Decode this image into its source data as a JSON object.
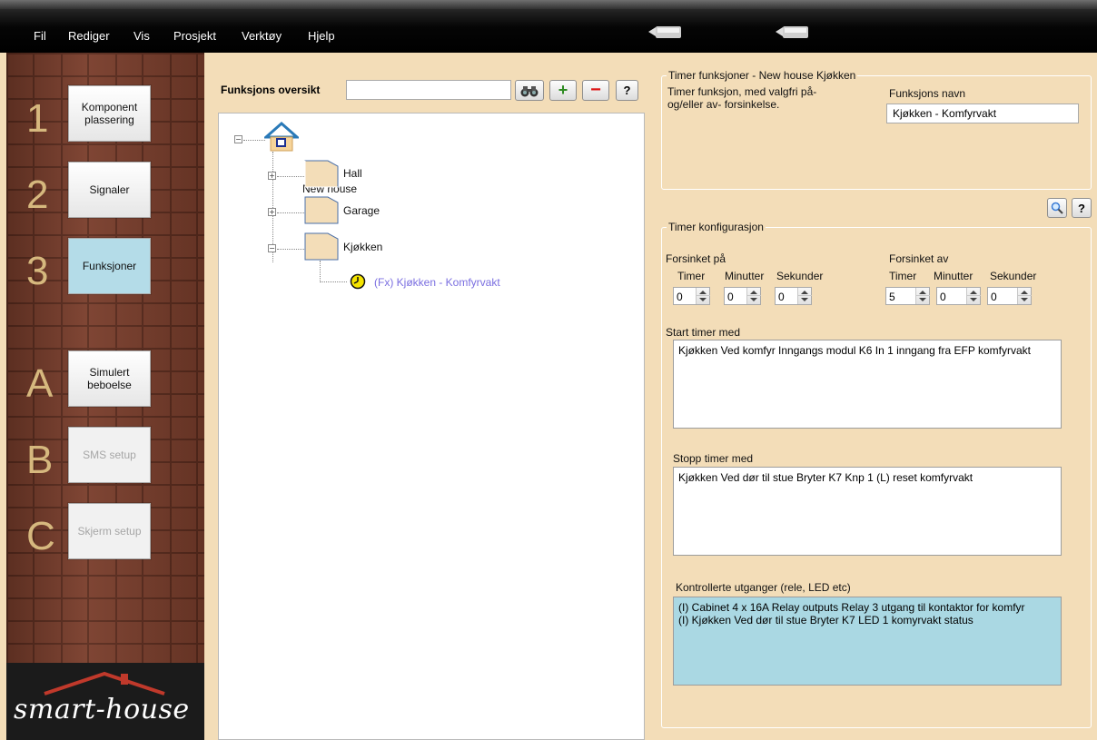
{
  "menu": [
    "Fil",
    "Rediger",
    "Vis",
    "Prosjekt",
    "Verktøy",
    "Hjelp"
  ],
  "nav": {
    "back_icon": "back-arrow-icon",
    "forward_icon": "forward-arrow-icon"
  },
  "sidebar": {
    "steps": [
      {
        "num": "1",
        "label_line1": "Komponent",
        "label_line2": "plassering",
        "state": "normal"
      },
      {
        "num": "2",
        "label_line1": "Signaler",
        "label_line2": "",
        "state": "normal"
      },
      {
        "num": "3",
        "label_line1": "Funksjoner",
        "label_line2": "",
        "state": "active"
      },
      {
        "num": "A",
        "label_line1": "Simulert",
        "label_line2": "beboelse",
        "state": "normal"
      },
      {
        "num": "B",
        "label_line1": "SMS setup",
        "label_line2": "",
        "state": "disabled"
      },
      {
        "num": "C",
        "label_line1": "Skjerm setup",
        "label_line2": "",
        "state": "disabled"
      }
    ],
    "logo_text": "smart-house"
  },
  "overview": {
    "label": "Funksjons oversikt",
    "search_value": "",
    "buttons": {
      "find_icon": "binoculars-icon",
      "add": "+",
      "remove": "−",
      "help": "?"
    },
    "tree": {
      "root": "New house",
      "rooms": [
        "Hall",
        "Garage",
        "Kjøkken"
      ],
      "function_item": "(Fx) Kjøkken - Komfyrvakt"
    }
  },
  "timer": {
    "group_title": "Timer funksjoner - New house  Kjøkken",
    "description_line1": "Timer funksjon, med valgfri på-",
    "description_line2": "og/eller av- forsinkelse.",
    "name_label": "Funksjons navn",
    "name_value": "Kjøkken - Komfyrvakt",
    "zoom_icon": "magnifier-icon",
    "help": "?",
    "config_title": "Timer konfigurasjon",
    "delay_on": {
      "title": "Forsinket på",
      "labels": [
        "Timer",
        "Minutter",
        "Sekunder"
      ],
      "values": [
        "0",
        "0",
        "0"
      ]
    },
    "delay_off": {
      "title": "Forsinket av",
      "labels": [
        "Timer",
        "Minutter",
        "Sekunder"
      ],
      "values": [
        "5",
        "0",
        "0"
      ]
    },
    "start_label": "Start timer med",
    "start_items": [
      "Kjøkken Ved komfyr Inngangs modul K6 In 1 inngang fra EFP komfyrvakt"
    ],
    "stop_label": "Stopp timer med",
    "stop_items": [
      "Kjøkken Ved dør til stue Bryter K7 Knp 1 (L)  reset komfyrvakt"
    ],
    "outputs_label": "Kontrollerte utganger (rele, LED etc)",
    "output_items": [
      "(I) Cabinet  4 x 16A Relay outputs Relay 3 utgang til kontaktor for komfyr",
      "(I) Kjøkken Ved dør til stue Bryter K7 LED 1 komyrvakt status"
    ]
  }
}
